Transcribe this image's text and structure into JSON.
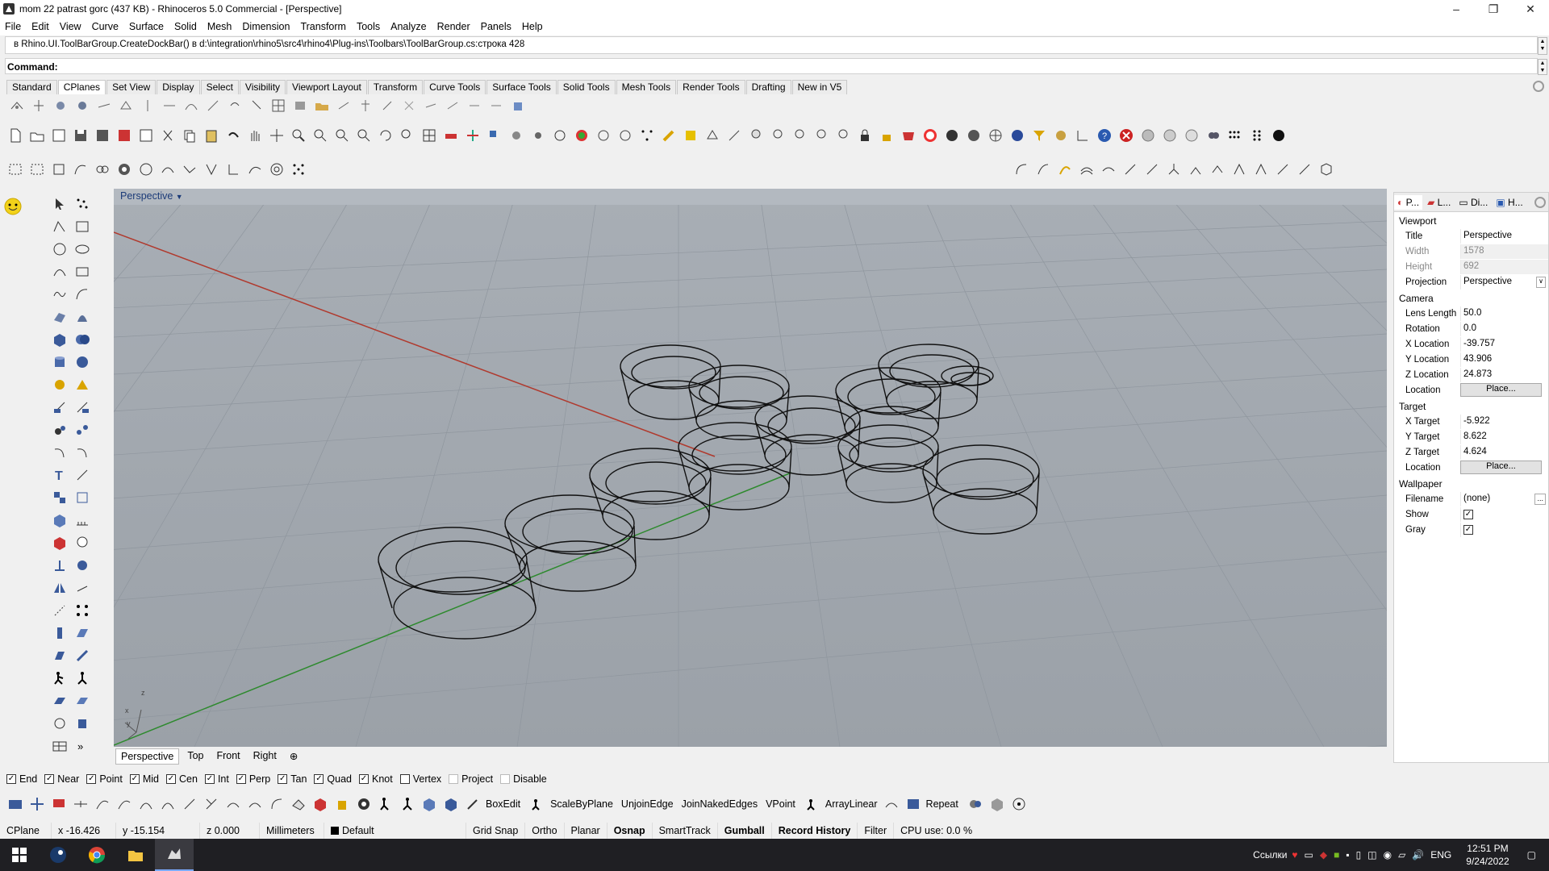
{
  "window": {
    "title": "mom 22 patrast gorc (437 KB) - Rhinoceros 5.0 Commercial - [Perspective]",
    "minimize": "–",
    "maximize": "❐",
    "close": "✕"
  },
  "menu": [
    "File",
    "Edit",
    "View",
    "Curve",
    "Surface",
    "Solid",
    "Mesh",
    "Dimension",
    "Transform",
    "Tools",
    "Analyze",
    "Render",
    "Panels",
    "Help"
  ],
  "command_history": "в Rhino.UI.ToolBarGroup.CreateDockBar() в d:\\integration\\rhino5\\src4\\rhino4\\Plug-ins\\Toolbars\\ToolBarGroup.cs:строка 428",
  "command_label": "Command:",
  "toolbar_tabs": [
    "Standard",
    "CPlanes",
    "Set View",
    "Display",
    "Select",
    "Visibility",
    "Viewport Layout",
    "Transform",
    "Curve Tools",
    "Surface Tools",
    "Solid Tools",
    "Mesh Tools",
    "Render Tools",
    "Drafting",
    "New in V5"
  ],
  "active_toolbar_tab": "CPlanes",
  "viewport": {
    "label": "Perspective",
    "axis_z": "z",
    "axis_x": "x",
    "axis_y": "y"
  },
  "viewport_tabs": [
    "Perspective",
    "Top",
    "Front",
    "Right"
  ],
  "viewport_tab_add": "⊕",
  "properties": {
    "tabs": [
      "P...",
      "L...",
      "Di...",
      "H..."
    ],
    "viewport_section": "Viewport",
    "title_label": "Title",
    "title_value": "Perspective",
    "width_label": "Width",
    "width_value": "1578",
    "height_label": "Height",
    "height_value": "692",
    "projection_label": "Projection",
    "projection_value": "Perspective",
    "camera_section": "Camera",
    "lens_label": "Lens Length",
    "lens_value": "50.0",
    "rotation_label": "Rotation",
    "rotation_value": "0.0",
    "xloc_label": "X Location",
    "xloc_value": "-39.757",
    "yloc_label": "Y Location",
    "yloc_value": "43.906",
    "zloc_label": "Z Location",
    "zloc_value": "24.873",
    "location_label": "Location",
    "place_label": "Place...",
    "target_section": "Target",
    "xt_label": "X Target",
    "xt_value": "-5.922",
    "yt_label": "Y Target",
    "yt_value": "8.622",
    "zt_label": "Z Target",
    "zt_value": "4.624",
    "tlocation_label": "Location",
    "tplace_label": "Place...",
    "wallpaper_section": "Wallpaper",
    "filename_label": "Filename",
    "filename_value": "(none)",
    "filename_btn": "...",
    "show_label": "Show",
    "gray_label": "Gray"
  },
  "osnaps": [
    {
      "label": "End",
      "checked": true
    },
    {
      "label": "Near",
      "checked": true
    },
    {
      "label": "Point",
      "checked": true
    },
    {
      "label": "Mid",
      "checked": true
    },
    {
      "label": "Cen",
      "checked": true
    },
    {
      "label": "Int",
      "checked": true
    },
    {
      "label": "Perp",
      "checked": true
    },
    {
      "label": "Tan",
      "checked": true
    },
    {
      "label": "Quad",
      "checked": true
    },
    {
      "label": "Knot",
      "checked": true
    },
    {
      "label": "Vertex",
      "checked": false
    },
    {
      "label": "Project",
      "checked": false
    },
    {
      "label": "Disable",
      "checked": false
    }
  ],
  "bottom_commands": [
    "BoxEdit",
    "ScaleByPlane",
    "UnjoinEdge",
    "JoinNakedEdges",
    "VPoint",
    "ArrayLinear",
    "Repeat"
  ],
  "status": {
    "cplane": "CPlane",
    "x": "x -16.426",
    "y": "y -15.154",
    "z": "z 0.000",
    "units": "Millimeters",
    "layer": "Default",
    "grid_snap": "Grid Snap",
    "ortho": "Ortho",
    "planar": "Planar",
    "osnap": "Osnap",
    "smarttrack": "SmartTrack",
    "gumball": "Gumball",
    "record_history": "Record History",
    "filter": "Filter",
    "cpu": "CPU use: 0.0 %"
  },
  "taskbar": {
    "links": "Ссылки",
    "lang": "ENG",
    "time": "12:51 PM",
    "date": "9/24/2022"
  },
  "colors": {
    "viewport_bg": "#a3a9b0",
    "x_axis": "#b03a2e",
    "y_axis": "#2e8a2e",
    "label_blue": "#1c3b78"
  }
}
